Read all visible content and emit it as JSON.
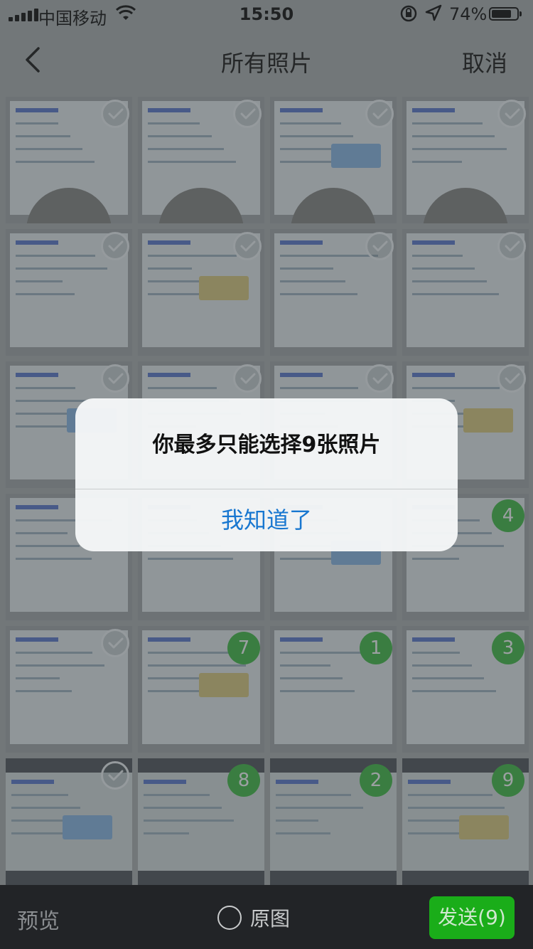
{
  "status_bar": {
    "carrier": "中国移动",
    "time": "15:50",
    "battery": "74%",
    "battery_level": 0.74
  },
  "nav": {
    "back_icon": "chevron-left-icon",
    "title": "所有照片",
    "cancel_label": "取消"
  },
  "photos": [
    {
      "state": "check"
    },
    {
      "state": "check"
    },
    {
      "state": "check"
    },
    {
      "state": "check"
    },
    {
      "state": "check"
    },
    {
      "state": "check"
    },
    {
      "state": "check"
    },
    {
      "state": "check"
    },
    {
      "state": "check"
    },
    {
      "state": "check"
    },
    {
      "state": "check"
    },
    {
      "state": "check"
    },
    {
      "state": "none"
    },
    {
      "state": "none"
    },
    {
      "state": "none"
    },
    {
      "state": "selected",
      "number": "4"
    },
    {
      "state": "check"
    },
    {
      "state": "selected",
      "number": "7"
    },
    {
      "state": "selected",
      "number": "1"
    },
    {
      "state": "selected",
      "number": "3"
    },
    {
      "state": "check"
    },
    {
      "state": "selected",
      "number": "8"
    },
    {
      "state": "selected",
      "number": "2"
    },
    {
      "state": "selected",
      "number": "9"
    }
  ],
  "alert": {
    "message": "你最多只能选择9张照片",
    "button": "我知道了"
  },
  "bottom_bar": {
    "preview_label": "预览",
    "original_label": "原图",
    "send_label": "发送(9)"
  },
  "colors": {
    "accent_green": "#1aad19",
    "link_blue": "#1877d0",
    "toolbar_bg": "#222427"
  }
}
